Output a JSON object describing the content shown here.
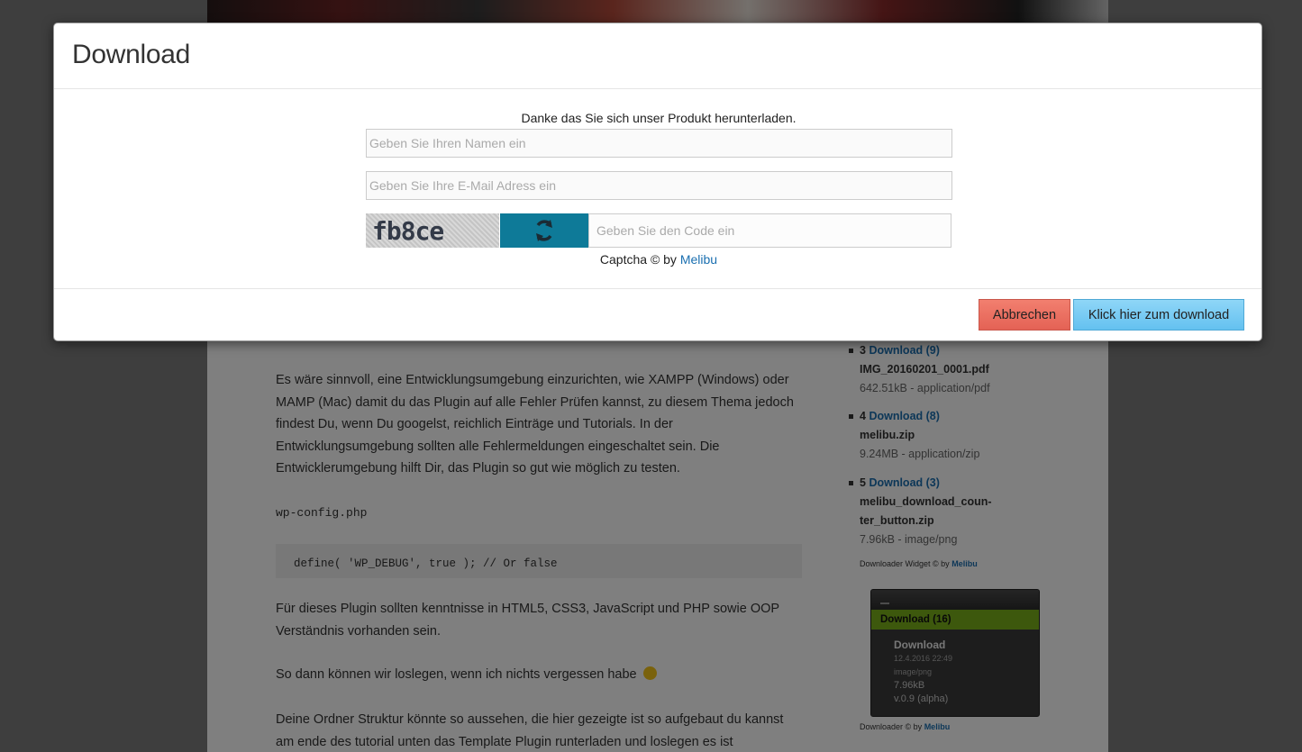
{
  "background": {
    "article": {
      "paragraph1": "Es wäre sinnvoll, eine Entwicklungsumgebung einzurichten, wie XAMPP (Windows) oder MAMP (Mac) damit du das Plugin auf alle Fehler Prüfen kannst, zu diesem Thema jedoch findest Du, wenn Du googelst, reichlich Einträge und Tutorials. In der Entwicklungsumgebung sollten alle Fehlermeldungen eingeschaltet sein. Die Entwicklerumgebung hilft Dir, das Plugin so gut wie möglich zu testen.",
      "code_label": "wp-config.php",
      "code": "define( 'WP_DEBUG', true ); // Or false",
      "paragraph2": "Für dieses Plugin sollten kenntnisse in HTML5, CSS3, JavaScript und PHP sowie OOP Verständnis vorhanden sein.",
      "paragraph3": "So dann können wir loslegen, wenn ich nichts vergessen habe",
      "paragraph4": "Deine Ordner Struktur könnte so aussehen, die hier gezeigte ist so aufgebaut du kannst am ende des tutorial unten das Template Plugin runterladen und loslegen es ist"
    },
    "sidebar": {
      "downloads": [
        {
          "num": "3",
          "link": "Download (9)",
          "file": "IMG_20160201_0001.pdf",
          "meta": "642.51kB - application/pdf"
        },
        {
          "num": "4",
          "link": "Download (8)",
          "file": "melibu.zip",
          "meta": "9.24MB - application/zip"
        },
        {
          "num": "5",
          "link": "Download (3)",
          "file": "melibu_download_coun-ter_button.zip",
          "meta": "7.96kB - image/png"
        }
      ],
      "widget_credit_text": "Downloader Widget © by",
      "widget_credit_link": "Melibu",
      "widget": {
        "bar": "Download (16)",
        "title": "Download",
        "date": "12.4.2016 22:49",
        "type": "image/png",
        "size": "7.96kB",
        "version": "v.0.9 (alpha)"
      },
      "downloader_credit_text": "Downloader © by",
      "downloader_credit_link": "Melibu"
    }
  },
  "modal": {
    "title": "Download",
    "intro": "Danke das Sie sich unser Produkt herunterladen.",
    "name_placeholder": "Geben Sie Ihren Namen ein",
    "email_placeholder": "Geben Sie Ihre E-Mail Adress ein",
    "captcha_text": "fb8ce",
    "code_placeholder": "Geben Sie den Code ein",
    "captcha_credit_text": "Captcha © by",
    "captcha_credit_link": "Melibu",
    "cancel_label": "Abbrechen",
    "download_label": "Klick hier zum download"
  },
  "colors": {
    "cancel_button": "#e46255",
    "download_button": "#64c1f0",
    "refresh_button": "#0e7a98",
    "link": "#1a6fb0",
    "widget_bar": "#7bb01a"
  }
}
